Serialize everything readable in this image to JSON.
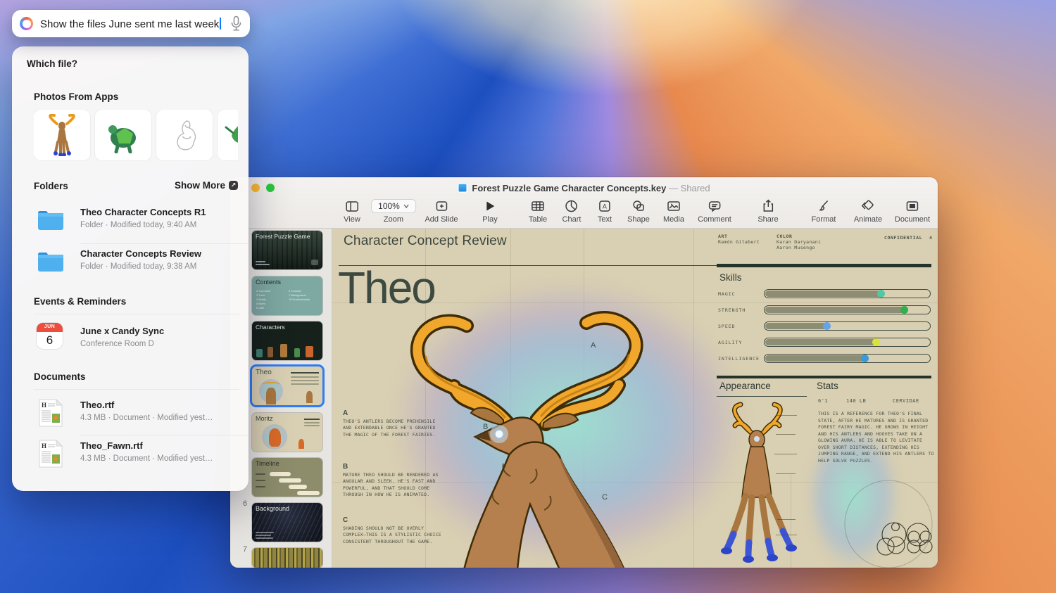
{
  "colors": {
    "accent_blue": "#2e7cf6",
    "slide_bg": "#d9cfb2",
    "slide_ink": "#3e4c44",
    "selection_border": "#2e7cf6",
    "calendar_red": "#ec4d3d",
    "folder_blue": "#4fb0f0"
  },
  "icons": {
    "assistant_orb": "siri-orb-icon",
    "microphone": "mic-icon",
    "show_more_arrow": "arrow-up-right-icon",
    "traffic_lights": [
      "close",
      "minimize",
      "zoom"
    ]
  },
  "assistant": {
    "query": "Show the files June sent me last week",
    "which_file": "Which file?",
    "photos_title": "Photos From Apps",
    "folders_title": "Folders",
    "show_more": "Show More",
    "folders": [
      {
        "name": "Theo Character Concepts R1",
        "meta": "Folder · Modified today, 9:40 AM"
      },
      {
        "name": "Character Concepts Review",
        "meta": "Folder · Modified today, 9:38 AM"
      }
    ],
    "events_title": "Events & Reminders",
    "event": {
      "month": "JUN",
      "day": "6",
      "name": "June x Candy Sync",
      "location": "Conference Room D"
    },
    "documents_title": "Documents",
    "documents": [
      {
        "name": "Theo.rtf",
        "meta": "4.3 MB · Document · Modified yest…"
      },
      {
        "name": "Theo_Fawn.rtf",
        "meta": "4.3 MB · Document · Modified yest…"
      }
    ]
  },
  "window": {
    "title": "Forest Puzzle Game Character Concepts.key",
    "dash": "—",
    "shared": "Shared",
    "toolbar": {
      "view": "View",
      "zoom": "Zoom",
      "zoom_value": "100%",
      "add_slide": "Add Slide",
      "play": "Play",
      "table": "Table",
      "chart": "Chart",
      "text": "Text",
      "shape": "Shape",
      "media": "Media",
      "comment": "Comment",
      "share": "Share",
      "format": "Format",
      "animate": "Animate",
      "document": "Document"
    }
  },
  "navigator": {
    "num6": "6",
    "num7": "7",
    "thumbs": {
      "s1": "Forest Puzzle Game",
      "s2": "Contents",
      "s3": "Characters",
      "s4": "Theo",
      "s5": "Moritz",
      "s6": "Timeline",
      "s7": "Background"
    },
    "contents_left": "2 Overview\n3 Theo\n4 Moritz\n5 Bram\n6 Lillie",
    "contents_right": "6 Timeline\n7 Background\n10 Environments"
  },
  "slide": {
    "header": "Character Concept Review",
    "art_label": "ART",
    "art_name": "Ramón Gilabert",
    "color_label": "COLOR",
    "color_name1": "Karan Daryanani",
    "color_name2": "Aaron Musengo",
    "confidential": "CONFIDENTIAL",
    "page_num": "4",
    "title": "Theo",
    "skills_title": "Skills",
    "skills": [
      {
        "label": "MAGIC",
        "pct": 72,
        "dot": "#54c6a2"
      },
      {
        "label": "STRENGTH",
        "pct": 86,
        "dot": "#2fb04c"
      },
      {
        "label": "SPEED",
        "pct": 39,
        "dot": "#64a4ea"
      },
      {
        "label": "AGILITY",
        "pct": 69,
        "dot": "#d8e33c"
      },
      {
        "label": "INTELLIGENCE",
        "pct": 62,
        "dot": "#3a99d8"
      }
    ],
    "appearance_title": "Appearance",
    "stats_title": "Stats",
    "stats_height": "6'1",
    "stats_weight": "140 LB",
    "stats_species": "CERVIDAE",
    "stats_text": "THIS IS A REFERENCE FOR THEO'S FINAL STATE, AFTER HE MATURES AND IS GRANTED FOREST FAIRY MAGIC. HE GROWS IN HEIGHT AND HIS ANTLERS AND HOOVES TAKE ON A GLOWING AURA. HE IS ABLE TO LEVITATE OVER SHORT DISTANCES, EXTENDING HIS JUMPING RANGE, AND EXTEND HIS ANTLERS TO HELP SOLVE PUZZLES.",
    "annotations": [
      {
        "letter": "A",
        "text": "THEO'S ANTLERS BECOME PREHENSILE AND EXTENDABLE ONCE HE'S GRANTED THE MAGIC OF THE FOREST FAIRIES."
      },
      {
        "letter": "B",
        "text": "MATURE THEO SHOULD BE RENDERED AS ANGULAR AND SLEEK. HE'S FAST AND POWERFUL, AND THAT SHOULD COME THROUGH IN HOW HE IS ANIMATED."
      },
      {
        "letter": "C",
        "text": "SHADING SHOULD NOT BE OVERLY COMPLEX—THIS IS A STYLISTIC CHOICE CONSISTENT THROUGHOUT THE GAME."
      }
    ],
    "markers": {
      "a": "A",
      "b": "B",
      "c": "C"
    }
  }
}
